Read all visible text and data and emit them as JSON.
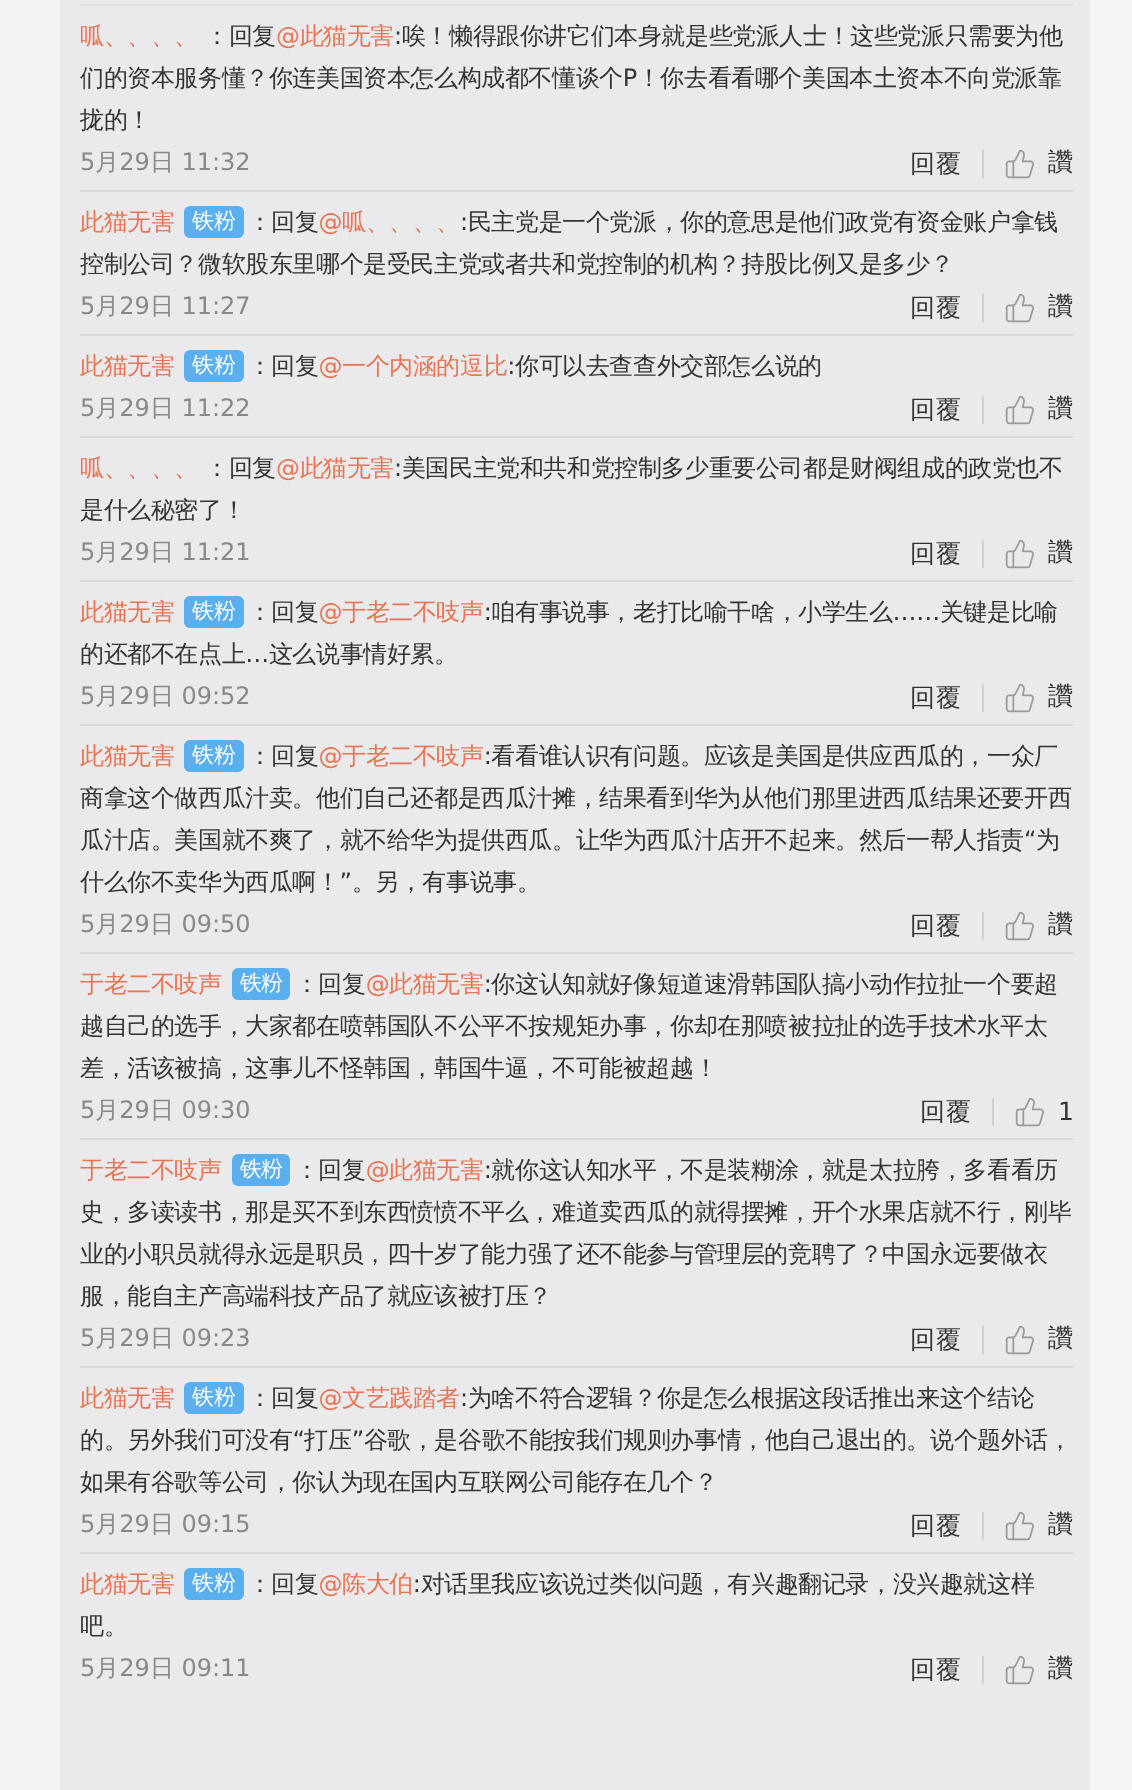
{
  "comments": [
    {
      "author": "呱、、、、",
      "prefix": " ：回复",
      "mention": "@此猫无害",
      "text": ":唉！懒得跟你讲它们本身就是些党派人士！这些党派只需要为他们的资本服务懂？你连美国资本怎么构成都不懂谈个P！你去看看哪个美国本土资本不向党派靠拢的！",
      "time": "5月29日 11:32",
      "reply": "回覆",
      "like": "讚"
    },
    {
      "author": "此猫无害",
      "badge": "铁粉",
      "prefix": "：回复",
      "mention": "@呱、、、、",
      "text": ":民主党是一个党派，你的意思是他们政党有资金账户拿钱控制公司？微软股东里哪个是受民主党或者共和党控制的机构？持股比例又是多少？",
      "time": "5月29日 11:27",
      "reply": "回覆",
      "like": "讚"
    },
    {
      "author": "此猫无害",
      "badge": "铁粉",
      "prefix": "：回复",
      "mention": "@一个内涵的逗比",
      "text": ":你可以去查查外交部怎么说的",
      "time": "5月29日 11:22",
      "reply": "回覆",
      "like": "讚"
    },
    {
      "author": "呱、、、、",
      "prefix": " ：回复",
      "mention": "@此猫无害",
      "text": ":美国民主党和共和党控制多少重要公司都是财阀组成的政党也不是什么秘密了！",
      "time": "5月29日 11:21",
      "reply": "回覆",
      "like": "讚"
    },
    {
      "author": "此猫无害",
      "badge": "铁粉",
      "prefix": "：回复",
      "mention": "@于老二不吱声",
      "text": ":咱有事说事，老打比喻干啥，小学生么……关键是比喻的还都不在点上…这么说事情好累。",
      "time": "5月29日 09:52",
      "reply": "回覆",
      "like": "讚"
    },
    {
      "author": "此猫无害",
      "badge": "铁粉",
      "prefix": "：回复",
      "mention": "@于老二不吱声",
      "text": ":看看谁认识有问题。应该是美国是供应西瓜的，一众厂商拿这个做西瓜汁卖。他们自己还都是西瓜汁摊，结果看到华为从他们那里进西瓜结果还要开西瓜汁店。美国就不爽了，就不给华为提供西瓜。让华为西瓜汁店开不起来。然后一帮人指责“为什么你不卖华为西瓜啊！”。另，有事说事。",
      "time": "5月29日 09:50",
      "reply": "回覆",
      "like": "讚"
    },
    {
      "author": "于老二不吱声",
      "badge": "铁粉",
      "prefix": "：回复",
      "mention": "@此猫无害",
      "text": ":你这认知就好像短道速滑韩国队搞小动作拉扯一个要超越自己的选手，大家都在喷韩国队不公平不按规矩办事，你却在那喷被拉扯的选手技术水平太差，活该被搞，这事儿不怪韩国，韩国牛逼，不可能被超越！",
      "time": "5月29日 09:30",
      "reply": "回覆",
      "like": "1"
    },
    {
      "author": "于老二不吱声",
      "badge": "铁粉",
      "prefix": "：回复",
      "mention": "@此猫无害",
      "text": ":就你这认知水平，不是装糊涂，就是太拉胯，多看看历史，多读读书，那是买不到东西愤愤不平么，难道卖西瓜的就得摆摊，开个水果店就不行，刚毕业的小职员就得永远是职员，四十岁了能力强了还不能参与管理层的竞聘了？中国永远要做衣服，能自主产高端科技产品了就应该被打压？",
      "time": "5月29日 09:23",
      "reply": "回覆",
      "like": "讚"
    },
    {
      "author": "此猫无害",
      "badge": "铁粉",
      "prefix": "：回复",
      "mention": "@文艺践踏者",
      "text": ":为啥不符合逻辑？你是怎么根据这段话推出来这个结论的。另外我们可没有“打压”谷歌，是谷歌不能按我们规则办事情，他自己退出的。说个题外话，如果有谷歌等公司，你认为现在国内互联网公司能存在几个？",
      "time": "5月29日 09:15",
      "reply": "回覆",
      "like": "讚"
    },
    {
      "author": "此猫无害",
      "badge": "铁粉",
      "prefix": "：回复",
      "mention": "@陈大伯",
      "text": ":对话里我应该说过类似问题，有兴趣翻记录，没兴趣就这样吧。",
      "time": "5月29日 09:11",
      "reply": "回覆",
      "like": "讚"
    }
  ]
}
